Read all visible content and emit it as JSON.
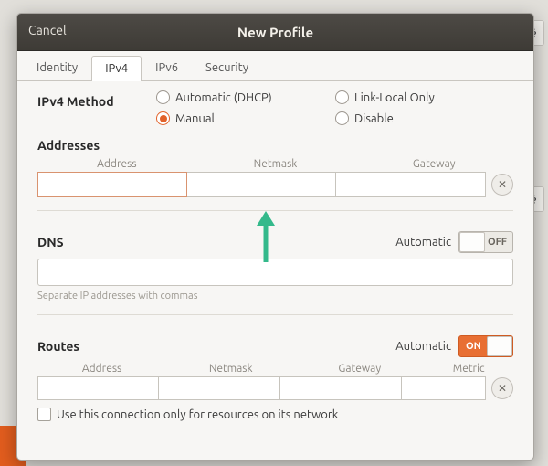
{
  "header": {
    "cancel": "Cancel",
    "title": "New Profile"
  },
  "tabs": [
    {
      "id": "identity",
      "label": "Identity"
    },
    {
      "id": "ipv4",
      "label": "IPv4"
    },
    {
      "id": "ipv6",
      "label": "IPv6"
    },
    {
      "id": "security",
      "label": "Security"
    }
  ],
  "active_tab": "ipv4",
  "method": {
    "label": "IPv4 Method",
    "options": {
      "auto": "Automatic (DHCP)",
      "linklocal": "Link-Local Only",
      "manual": "Manual",
      "disable": "Disable"
    },
    "selected": "manual"
  },
  "addresses": {
    "label": "Addresses",
    "columns": {
      "address": "Address",
      "netmask": "Netmask",
      "gateway": "Gateway"
    },
    "rows": [
      {
        "address": "",
        "netmask": "",
        "gateway": ""
      }
    ]
  },
  "dns": {
    "label": "DNS",
    "automatic_label": "Automatic",
    "automatic_on": false,
    "switch_off_text": "OFF",
    "switch_on_text": "ON",
    "value": "",
    "hint": "Separate IP addresses with commas"
  },
  "routes": {
    "label": "Routes",
    "automatic_label": "Automatic",
    "automatic_on": true,
    "switch_on_text": "ON",
    "columns": {
      "address": "Address",
      "netmask": "Netmask",
      "gateway": "Gateway",
      "metric": "Metric"
    },
    "rows": [
      {
        "address": "",
        "netmask": "",
        "gateway": "",
        "metric": ""
      }
    ],
    "only_resources_label": "Use this connection only for resources on its network",
    "only_resources_checked": false
  },
  "icons": {
    "gear": "gear-icon",
    "delete": "close-icon"
  },
  "colors": {
    "accent": "#e2622a"
  }
}
